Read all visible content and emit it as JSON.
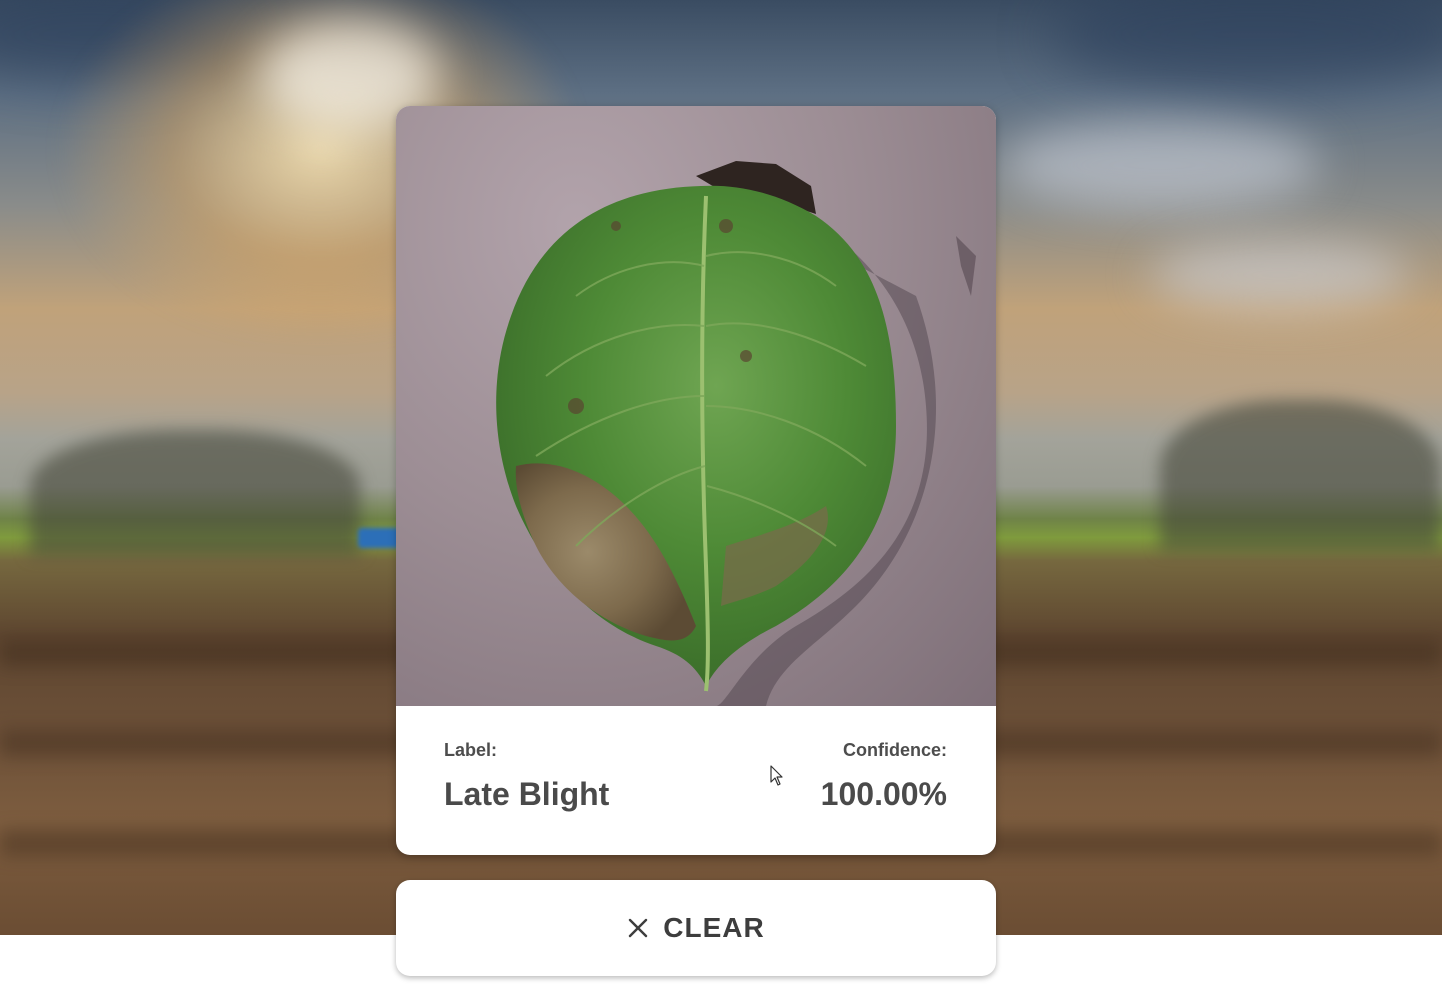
{
  "result": {
    "label_caption": "Label:",
    "label_value": "Late Blight",
    "confidence_caption": "Confidence:",
    "confidence_value": "100.00%"
  },
  "actions": {
    "clear_label": "CLEAR",
    "clear_icon": "close-icon"
  },
  "images": {
    "background": "blurred-farm-field-sky",
    "uploaded": "potato-leaf-with-blight"
  },
  "colors": {
    "card_background": "#ffffff",
    "text_primary": "#4a4a4a",
    "leaf_green": "#4e8a36"
  }
}
